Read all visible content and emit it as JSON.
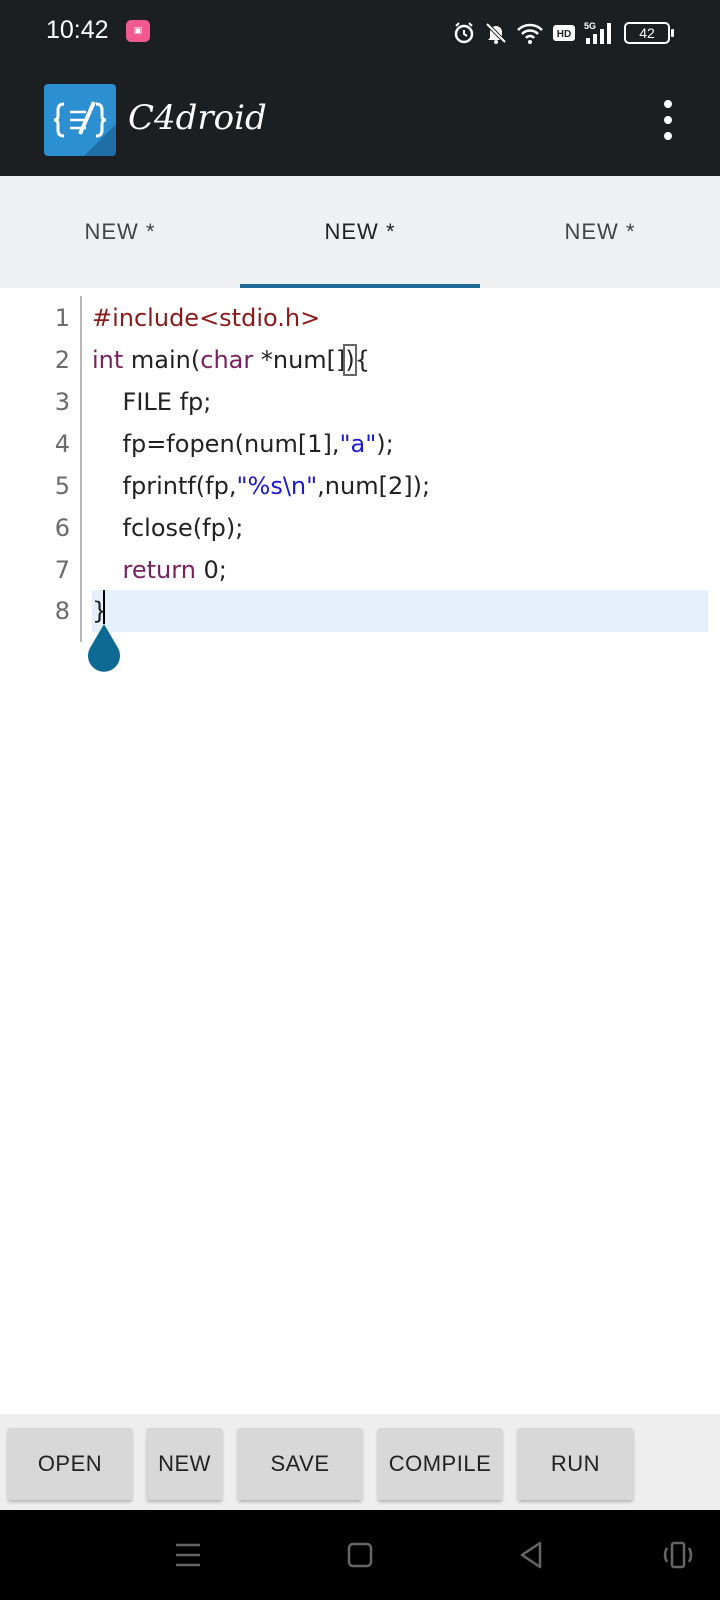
{
  "status_bar": {
    "time": "10:42",
    "battery": "42",
    "icons": [
      "notification-app-icon",
      "alarm-icon",
      "mute-icon",
      "wifi-icon",
      "hd-icon",
      "signal-5g-icon",
      "battery-icon"
    ]
  },
  "app_bar": {
    "title": "C4droid",
    "logo_icon": "c4droid-logo-icon",
    "menu_icon": "more-vert-icon"
  },
  "tabs": [
    {
      "label": "NEW *",
      "active": false
    },
    {
      "label": "NEW *",
      "active": true
    },
    {
      "label": "NEW *",
      "active": false
    }
  ],
  "editor": {
    "lines": [
      {
        "number": "1"
      },
      {
        "number": "2"
      },
      {
        "number": "3"
      },
      {
        "number": "4"
      },
      {
        "number": "5"
      },
      {
        "number": "6"
      },
      {
        "number": "7"
      },
      {
        "number": "8"
      }
    ],
    "tokens": {
      "l1_pre": "#include<stdio.h>",
      "l2_int": "int",
      "l2_main": " main(",
      "l2_char": "char",
      "l2_rest": " *num[]",
      "l2_paren": ")",
      "l2_brace": "{",
      "l3": "    FILE fp;",
      "l4_a": "    fp=fopen(num[1],",
      "l4_str": "\"a\"",
      "l4_b": ");",
      "l5_a": "    fprintf(fp,",
      "l5_str": "\"%s\\n\"",
      "l5_b": ",num[2]);",
      "l6": "    fclose(fp);",
      "l7_indent": "    ",
      "l7_kw": "return",
      "l7_rest": " 0;",
      "l8": "}"
    },
    "colors": {
      "preprocessor": "#8b1a1a",
      "keyword": "#7a1f5f",
      "string": "#1a1ad0",
      "current_line": "#e6f0fc",
      "handle": "#0f6a93"
    }
  },
  "toolbar": {
    "open_label": "OPEN",
    "new_label": "NEW",
    "save_label": "SAVE",
    "compile_label": "COMPILE",
    "run_label": "RUN"
  },
  "nav_bar": {
    "icons": [
      "menu-icon",
      "home-icon",
      "back-icon",
      "rotate-icon"
    ]
  }
}
